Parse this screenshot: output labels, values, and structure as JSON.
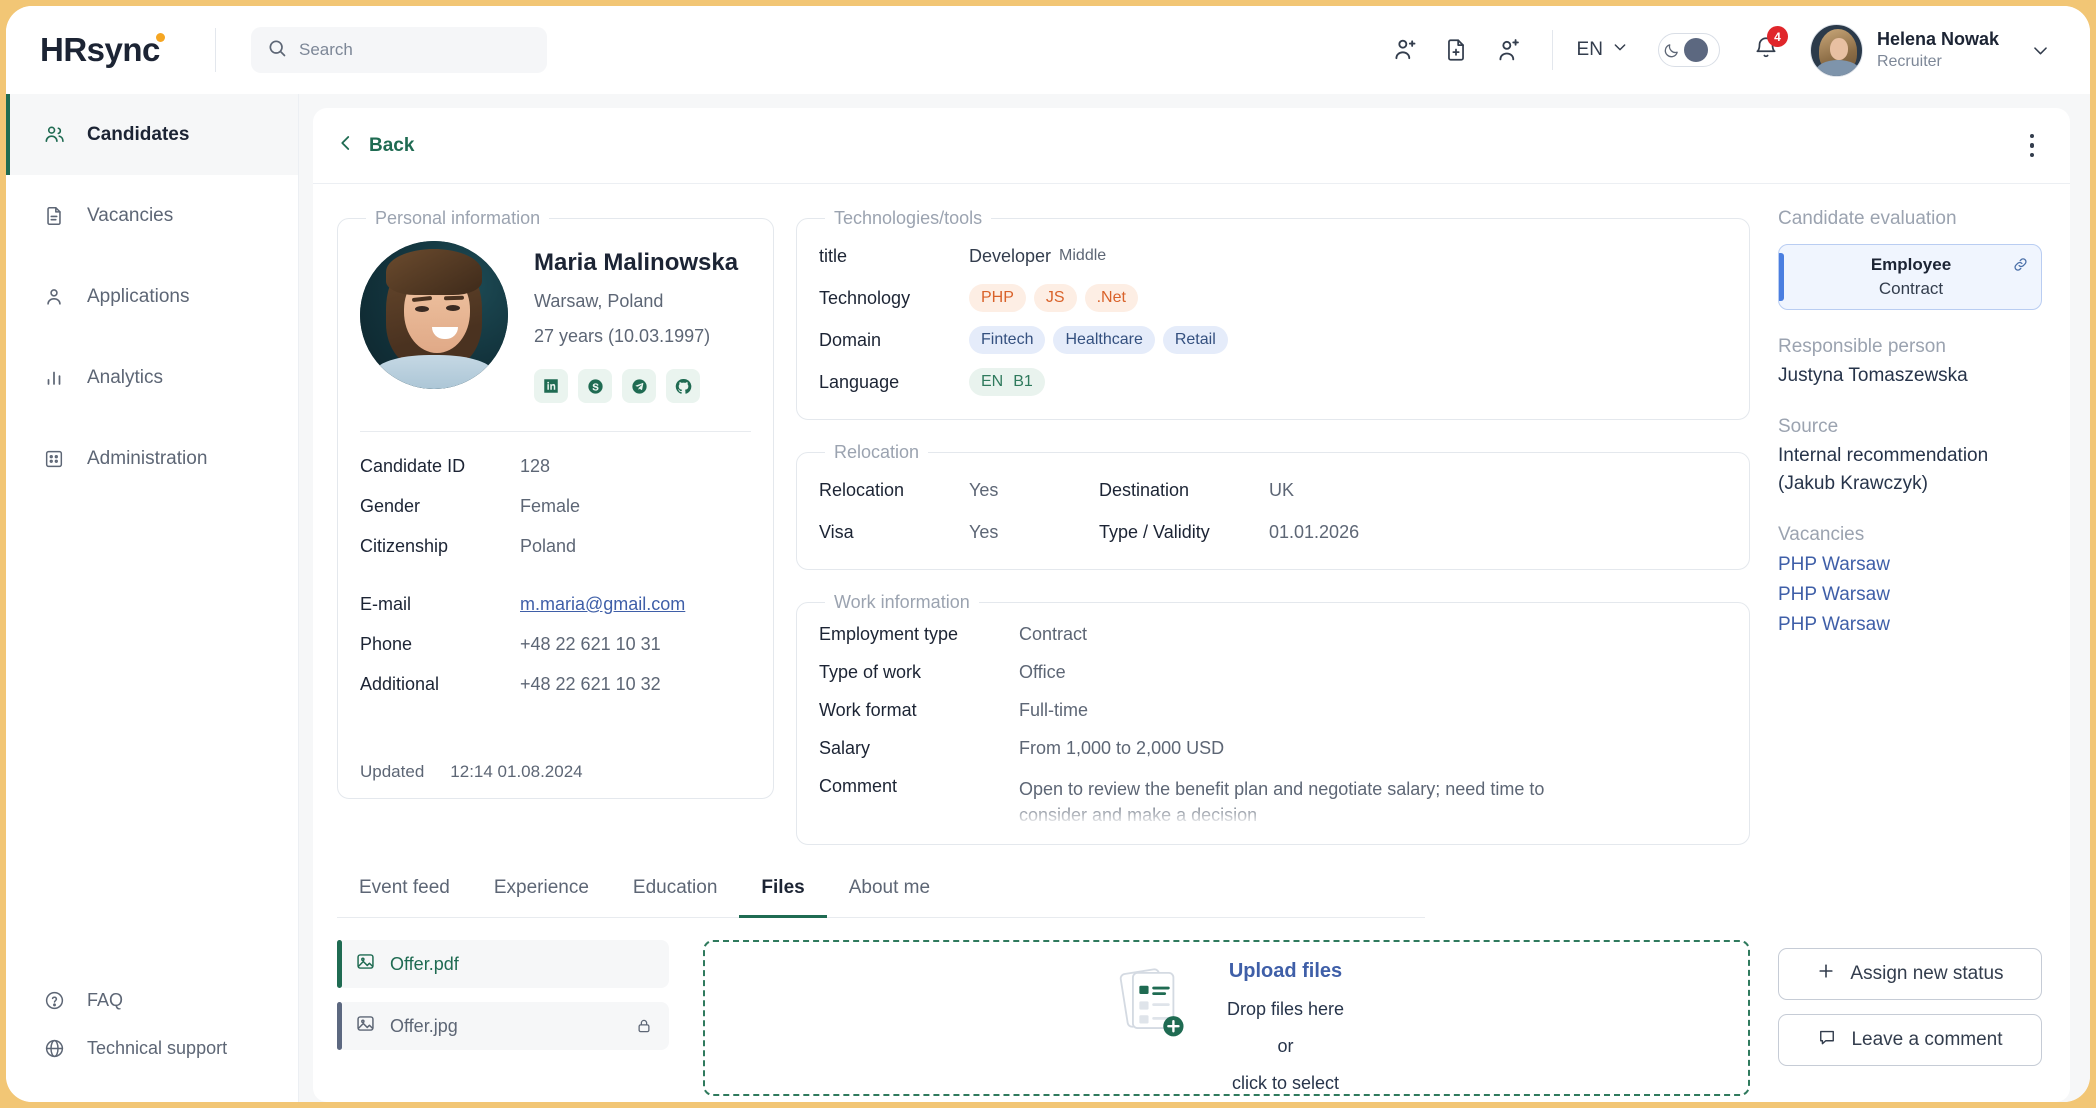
{
  "header": {
    "logo": "HRsync",
    "search_placeholder": "Search",
    "search_value": "",
    "icons": [
      "add-group-icon",
      "add-document-icon",
      "add-person-icon"
    ],
    "language": "EN",
    "notifications_count": "4",
    "user_name": "Helena Nowak",
    "user_role": "Recruiter"
  },
  "sidebar": {
    "items": [
      {
        "label": "Candidates",
        "icon": "people-icon",
        "active": true
      },
      {
        "label": "Vacancies",
        "icon": "document-icon",
        "active": false
      },
      {
        "label": "Applications",
        "icon": "person-icon",
        "active": false
      },
      {
        "label": "Analytics",
        "icon": "bar-chart-icon",
        "active": false
      },
      {
        "label": "Administration",
        "icon": "grid-icon",
        "active": false
      }
    ],
    "footer": [
      {
        "label": "FAQ",
        "icon": "question-circle-icon"
      },
      {
        "label": "Technical support",
        "icon": "globe-icon"
      }
    ]
  },
  "toolbar": {
    "back_label": "Back"
  },
  "personal": {
    "legend": "Personal information",
    "name": "Maria Malinowska",
    "location": "Warsaw, Poland",
    "age": "27 years (10.03.1997)",
    "socials": [
      "linkedin-icon",
      "skype-icon",
      "telegram-icon",
      "github-icon"
    ],
    "rows": [
      {
        "key": "Candidate ID",
        "value": "128"
      },
      {
        "key": "Gender",
        "value": "Female"
      },
      {
        "key": "Citizenship",
        "value": "Poland"
      }
    ],
    "contact": [
      {
        "key": "E-mail",
        "value": "m.maria@gmail.com",
        "link": true
      },
      {
        "key": "Phone",
        "value": "+48 22 621 10 31"
      },
      {
        "key": "Additional",
        "value": "+48 22 621 10 32"
      }
    ],
    "updated_label": "Updated",
    "updated_value": "12:14 01.08.2024"
  },
  "technologies": {
    "legend": "Technologies/tools",
    "title_key": "title",
    "title_value": "Developer",
    "title_level": "Middle",
    "technology_key": "Technology",
    "technology_tags": [
      "PHP",
      "JS",
      ".Net"
    ],
    "domain_key": "Domain",
    "domain_tags": [
      "Fintech",
      "Healthcare",
      "Retail"
    ],
    "language_key": "Language",
    "language_code": "EN",
    "language_level": "B1"
  },
  "relocation": {
    "legend": "Relocation",
    "rows": [
      {
        "k1": "Relocation",
        "v1": "Yes",
        "k2": "Destination",
        "v2": "UK"
      },
      {
        "k1": "Visa",
        "v1": "Yes",
        "k2": "Type / Validity",
        "v2": "01.01.2026"
      }
    ]
  },
  "work": {
    "legend": "Work information",
    "rows": [
      {
        "key": "Employment type",
        "value": "Contract"
      },
      {
        "key": "Type of work",
        "value": "Office"
      },
      {
        "key": "Work format",
        "value": "Full-time"
      },
      {
        "key": "Salary",
        "value": "From 1,000 to 2,000 USD"
      }
    ],
    "comment_key": "Comment",
    "comment_value": "Open to review the benefit plan and negotiate salary; need time to consider and make a decision"
  },
  "evaluation": {
    "title": "Candidate evaluation",
    "status_primary": "Employee",
    "status_secondary": "Contract",
    "responsible_label": "Responsible person",
    "responsible_value": "Justyna Tomaszewska",
    "source_label": "Source",
    "source_value": "Internal recommendation (Jakub Krawczyk)",
    "vacancies_label": "Vacancies",
    "vacancies": [
      "PHP Warsaw",
      "PHP Warsaw",
      "PHP Warsaw"
    ],
    "assign_status_label": "Assign new status",
    "leave_comment_label": "Leave a comment"
  },
  "tabs": [
    {
      "label": "Event feed",
      "active": false
    },
    {
      "label": "Experience",
      "active": false
    },
    {
      "label": "Education",
      "active": false
    },
    {
      "label": "Files",
      "active": true
    },
    {
      "label": "About me",
      "active": false
    }
  ],
  "files": {
    "items": [
      {
        "name": "Offer.pdf",
        "selected": true,
        "locked": false
      },
      {
        "name": "Offer.jpg",
        "selected": false,
        "locked": true
      }
    ],
    "upload_title": "Upload files",
    "drop_line1": "Drop files here",
    "drop_line2": "or",
    "drop_line3": "click to select"
  },
  "colors": {
    "accent_green": "#1f6b52",
    "accent_blue": "#3f5fa8",
    "badge_red": "#e0262b",
    "logo_dot": "#f5a623",
    "page_border": "#f2c675"
  }
}
